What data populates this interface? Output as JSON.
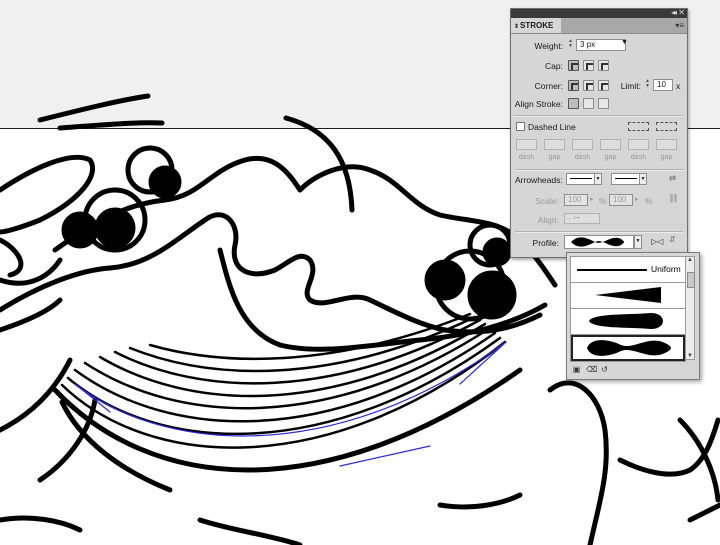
{
  "panel": {
    "tab_label": "STROKE",
    "weight": {
      "label": "Weight:",
      "value": "3 px"
    },
    "cap": {
      "label": "Cap:"
    },
    "corner": {
      "label": "Corner:",
      "limit_label": "Limit:",
      "limit_value": "10",
      "limit_unit": "x"
    },
    "align_stroke": {
      "label": "Align Stroke:"
    },
    "dashed_line": {
      "label": "Dashed Line",
      "checked": false,
      "field_labels": [
        "dash",
        "gap",
        "dash",
        "gap",
        "dash",
        "gap"
      ]
    },
    "arrowheads": {
      "label": "Arrowheads:"
    },
    "scale": {
      "label": "Scale:",
      "start": "100",
      "end": "100",
      "unit": "%"
    },
    "align": {
      "label": "Align:"
    },
    "profile": {
      "label": "Profile:"
    }
  },
  "profile_list": {
    "items": [
      "Uniform",
      "",
      "",
      ""
    ],
    "selected_index": 3
  },
  "colors": {
    "pasteboard": "#f0f0f0",
    "panel_bg": "#d6d6d6",
    "selection_path": "#2b2bd6"
  },
  "icons": {
    "collapse": "double-chevron-right-icon",
    "close": "close-icon",
    "panel_menu": "panel-menu-icon",
    "swap_arrowheads": "swap-arrows-icon",
    "link_scale": "chain-link-icon",
    "flip_profile": "flip-horizontal-icon",
    "flip_vertical": "flip-vertical-icon"
  }
}
